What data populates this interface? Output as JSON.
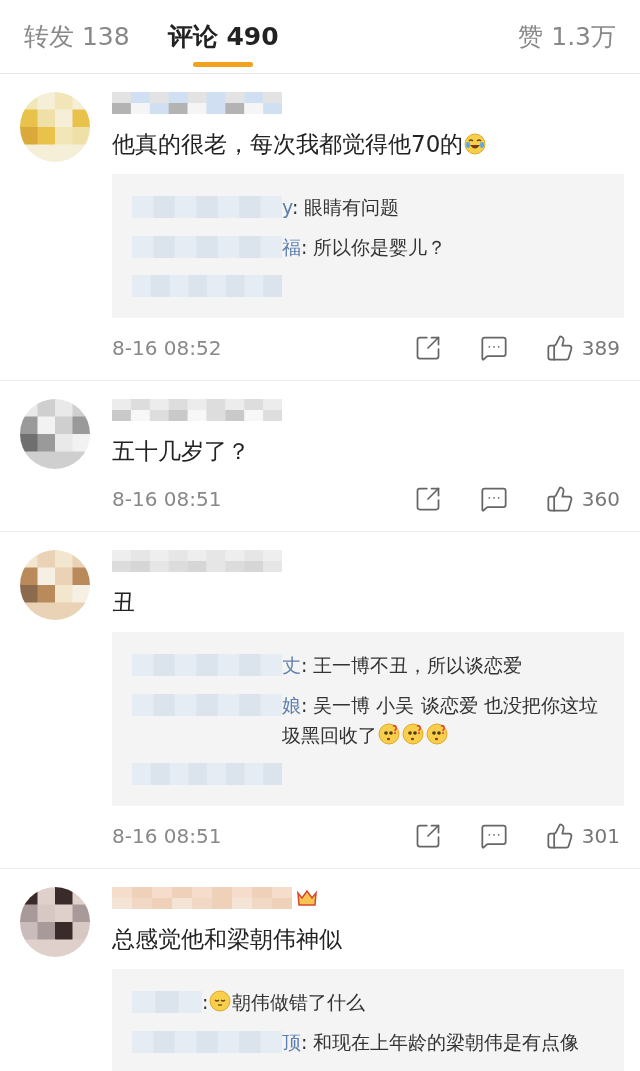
{
  "tabs": [
    {
      "label": "转发 138",
      "selected": false
    },
    {
      "label": "评论 490",
      "selected": true
    },
    {
      "label": "赞 1.3万",
      "selected": false
    }
  ],
  "comments": [
    {
      "text": "他真的很老，每次我都觉得他70的",
      "emojis_after": [
        {
          "kind": "laugh"
        }
      ],
      "replies": [
        {
          "name_tail": "y",
          "text": ": 眼睛有问题"
        },
        {
          "name_tail": "福",
          "text": ": 所以你是婴儿？"
        },
        {
          "kind": "more"
        }
      ],
      "time": "8-16 08:52",
      "likes": "389"
    },
    {
      "text": "五十几岁了？",
      "time": "8-16 08:51",
      "likes": "360"
    },
    {
      "text": "丑",
      "replies": [
        {
          "name_tail": "丈",
          "text": ": 王一博不丑，所以谈恋爱"
        },
        {
          "name_tail": "娘",
          "text": ": 吴一博 小吴 谈恋爱  也没把你这垃圾黑回收了",
          "emojis_after": [
            {
              "kind": "puzzled"
            },
            {
              "kind": "puzzled"
            },
            {
              "kind": "puzzled"
            }
          ]
        },
        {
          "kind": "more"
        }
      ],
      "time": "8-16 08:51",
      "likes": "301"
    },
    {
      "text": "总感觉他和梁朝伟神似",
      "badge": true,
      "replies": [
        {
          "text": ":",
          "emojis_after": [
            {
              "kind": "awkward"
            }
          ],
          "text_after": "朝伟做错了什么"
        },
        {
          "name_tail": "顶",
          "text": ": 和现在上年龄的梁朝伟是有点像"
        }
      ]
    }
  ]
}
